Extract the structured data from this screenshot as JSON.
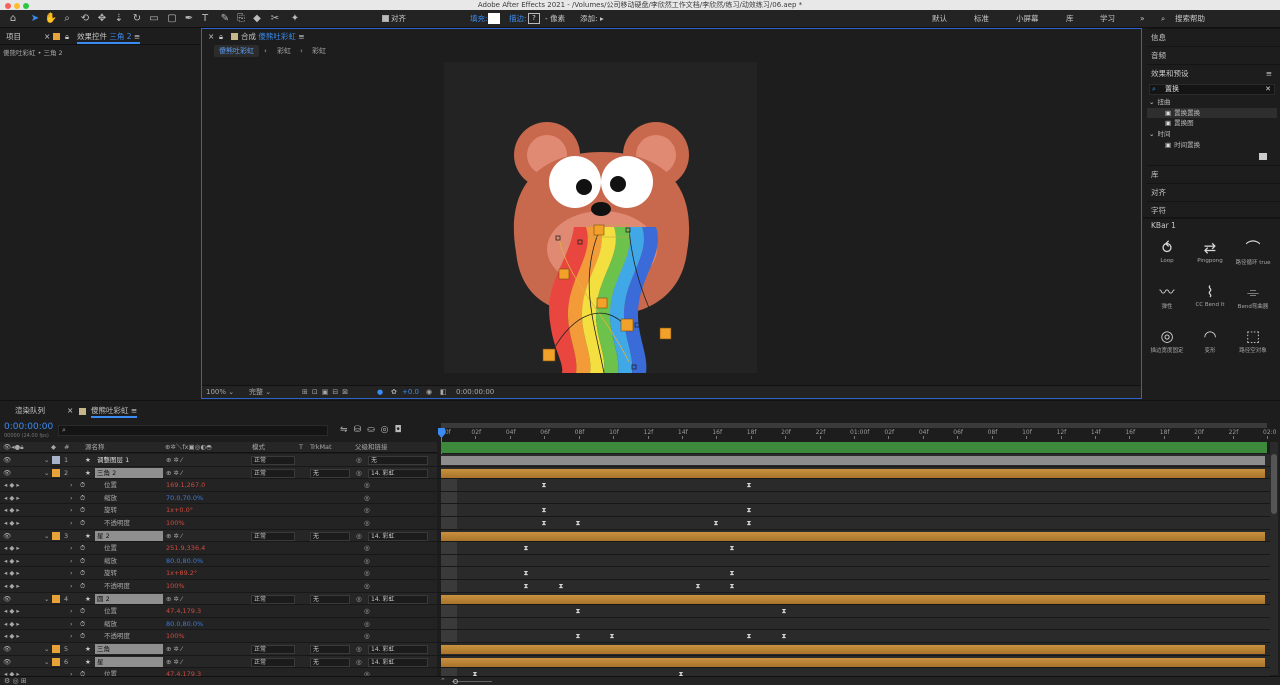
{
  "window": {
    "title": "Adobe After Effects 2021 - /Volumes/公司移动硬盘/李欣然工作文档/李欣然/练习/动效练习/06.aep *"
  },
  "toolbar": {
    "align_label": "对齐",
    "fill_label": "填充:",
    "stroke_label": "描边:",
    "stroke_value": "?",
    "px_label": "- 像素",
    "add_label": "添加:",
    "icons": [
      "home-icon",
      "select-arrow-icon",
      "hand-icon",
      "zoom-icon",
      "orbit-icon",
      "pan-icon",
      "dolly-icon",
      "rotate-icon",
      "camera-icon",
      "rect-tool-icon",
      "pen-tool-icon",
      "text-tool-icon",
      "brush-icon",
      "clone-icon",
      "eraser-icon",
      "roto-icon",
      "pin-icon"
    ]
  },
  "workspaces": {
    "items": [
      "默认",
      "标准",
      "小屏幕",
      "库",
      "学习"
    ],
    "search_label": "搜索帮助"
  },
  "project_panel": {
    "tab": "项目",
    "effects_tab": "效果控件",
    "effects_target": "三角 2",
    "breadcrumb": "傻熊吐彩虹 • 三角 2"
  },
  "comp_panel": {
    "tab_prefix": "合成",
    "tab_name": "傻熊吐彩虹",
    "nav": [
      "傻熊吐彩虹",
      "彩虹",
      "彩虹"
    ],
    "zoom": "100%",
    "quality": "完整",
    "exposure": "+0.0",
    "timecode": "0:00:00:00"
  },
  "right_panel": {
    "sections": [
      "信息",
      "音频",
      "效果和预设"
    ],
    "search_value": "置换",
    "tree": [
      {
        "label": "扭曲",
        "type": "folder"
      },
      {
        "label": "置换置换",
        "type": "item"
      },
      {
        "label": "置换图",
        "type": "item"
      },
      {
        "label": "时间",
        "type": "folder"
      },
      {
        "label": "时间置换",
        "type": "item"
      }
    ],
    "lower_sections": [
      "库",
      "对齐",
      "字符"
    ],
    "kbar_title": "KBar 1",
    "kbar_items": [
      {
        "label": "Loop",
        "icon": "loop-icon",
        "glyph": "⥀"
      },
      {
        "label": "Pingpong",
        "icon": "pingpong-icon",
        "glyph": "⇄"
      },
      {
        "label": "路径循环 true",
        "icon": "path-loop-icon",
        "glyph": "⌒"
      },
      {
        "label": "弹性",
        "icon": "elastic-icon",
        "glyph": "〰"
      },
      {
        "label": "CC Bend It",
        "icon": "bend-it-icon",
        "glyph": "⌇"
      },
      {
        "label": "Bend弯曲器",
        "icon": "bend-icon",
        "glyph": "⌯"
      },
      {
        "label": "描边宽度固定",
        "icon": "stroke-width-icon",
        "glyph": "◎"
      },
      {
        "label": "变形",
        "icon": "warp-icon",
        "glyph": "◠"
      },
      {
        "label": "路径空对象",
        "icon": "path-null-icon",
        "glyph": "⬚"
      }
    ]
  },
  "timeline": {
    "render_queue_tab": "渲染队列",
    "comp_tab": "傻熊吐彩虹",
    "timecode": "0:00:00:00",
    "fps": "00000 (24.00 fps)",
    "headers": {
      "num": "#",
      "source": "源名称",
      "mode": "模式",
      "t": "T",
      "trkmat": "TrkMat",
      "parent": "父级和链接"
    },
    "ruler": [
      "00f",
      "02f",
      "04f",
      "06f",
      "08f",
      "10f",
      "12f",
      "14f",
      "16f",
      "18f",
      "20f",
      "22f",
      "01:00f",
      "02f",
      "04f",
      "06f",
      "08f",
      "10f",
      "12f",
      "14f",
      "16f",
      "18f",
      "20f",
      "22f",
      "02:0"
    ],
    "rows": [
      {
        "kind": "layer",
        "num": "1",
        "name": "调整图层 1",
        "color": "#a7b3c8",
        "mode": "正常",
        "trk": "",
        "parent": "无",
        "sel": false
      },
      {
        "kind": "layer",
        "num": "2",
        "name": "三角 2",
        "color": "#e8a23a",
        "mode": "正常",
        "trk": "无",
        "parent": "14. 彩虹",
        "sel": true
      },
      {
        "kind": "prop",
        "name": "位置",
        "value": "169.1,267.0",
        "vc": "red",
        "keys": [
          544,
          749
        ]
      },
      {
        "kind": "prop",
        "name": "缩放",
        "value": "70.0,70.0%",
        "vc": "blue",
        "keys": []
      },
      {
        "kind": "prop",
        "name": "旋转",
        "value": "1x+0.0°",
        "vc": "red",
        "keys": [
          544,
          749
        ]
      },
      {
        "kind": "prop",
        "name": "不透明度",
        "value": "100%",
        "vc": "red",
        "keys": [
          544,
          578,
          716,
          749
        ]
      },
      {
        "kind": "layer",
        "num": "3",
        "name": "星 2",
        "color": "#e8a23a",
        "mode": "正常",
        "trk": "无",
        "parent": "14. 彩虹",
        "sel": true
      },
      {
        "kind": "prop",
        "name": "位置",
        "value": "251.9,336.4",
        "vc": "red",
        "keys": [
          526,
          732
        ]
      },
      {
        "kind": "prop",
        "name": "缩放",
        "value": "80.0,80.0%",
        "vc": "blue",
        "keys": []
      },
      {
        "kind": "prop",
        "name": "旋转",
        "value": "1x+89.2°",
        "vc": "red",
        "keys": [
          526,
          732
        ]
      },
      {
        "kind": "prop",
        "name": "不透明度",
        "value": "100%",
        "vc": "red",
        "keys": [
          526,
          561,
          698,
          732
        ]
      },
      {
        "kind": "layer",
        "num": "4",
        "name": "圆 2",
        "color": "#e8a23a",
        "mode": "正常",
        "trk": "无",
        "parent": "14. 彩虹",
        "sel": true
      },
      {
        "kind": "prop",
        "name": "位置",
        "value": "47.4,179.3",
        "vc": "red",
        "keys": [
          578,
          784
        ]
      },
      {
        "kind": "prop",
        "name": "缩放",
        "value": "80.0,80.0%",
        "vc": "blue",
        "keys": []
      },
      {
        "kind": "prop",
        "name": "不透明度",
        "value": "100%",
        "vc": "red",
        "keys": [
          578,
          612,
          749,
          784
        ]
      },
      {
        "kind": "layer",
        "num": "5",
        "name": "三角",
        "color": "#e8a23a",
        "mode": "正常",
        "trk": "无",
        "parent": "14. 彩虹",
        "sel": true
      },
      {
        "kind": "layer",
        "num": "6",
        "name": "星",
        "color": "#e8a23a",
        "mode": "正常",
        "trk": "无",
        "parent": "14. 彩虹",
        "sel": true
      },
      {
        "kind": "prop",
        "name": "位置",
        "value": "47.4,179.3",
        "vc": "red",
        "keys": [
          475,
          681
        ]
      }
    ]
  }
}
